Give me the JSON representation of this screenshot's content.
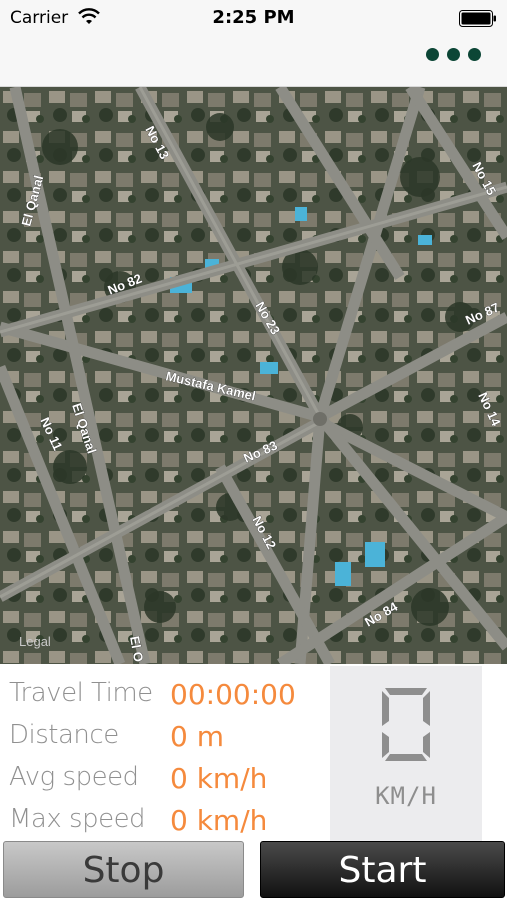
{
  "status_bar": {
    "carrier": "Carrier",
    "time": "2:25 PM"
  },
  "nav": {
    "menu_icon": "more-dots-icon"
  },
  "map": {
    "legal": "Legal",
    "street_labels": [
      "No 13",
      "No 15",
      "El Qanal",
      "No 82",
      "No 23",
      "No 87",
      "Mustafa Kamel",
      "No 83",
      "El Qanal",
      "No 11",
      "No 14",
      "No 12",
      "No 84",
      "El O"
    ]
  },
  "stats": {
    "rows": [
      {
        "label": "Travel Time",
        "value": "00:00:00"
      },
      {
        "label": "Distance",
        "value": "0 m"
      },
      {
        "label": "Avg speed",
        "value": "0 km/h"
      },
      {
        "label": "Max speed",
        "value": "0 km/h"
      }
    ]
  },
  "speedometer": {
    "value": "0",
    "unit": "KM/H"
  },
  "buttons": {
    "stop": "Stop",
    "start": "Start"
  },
  "colors": {
    "accent": "#f58a3d",
    "menu_dots": "#0c4636",
    "label_gray": "#909090"
  }
}
